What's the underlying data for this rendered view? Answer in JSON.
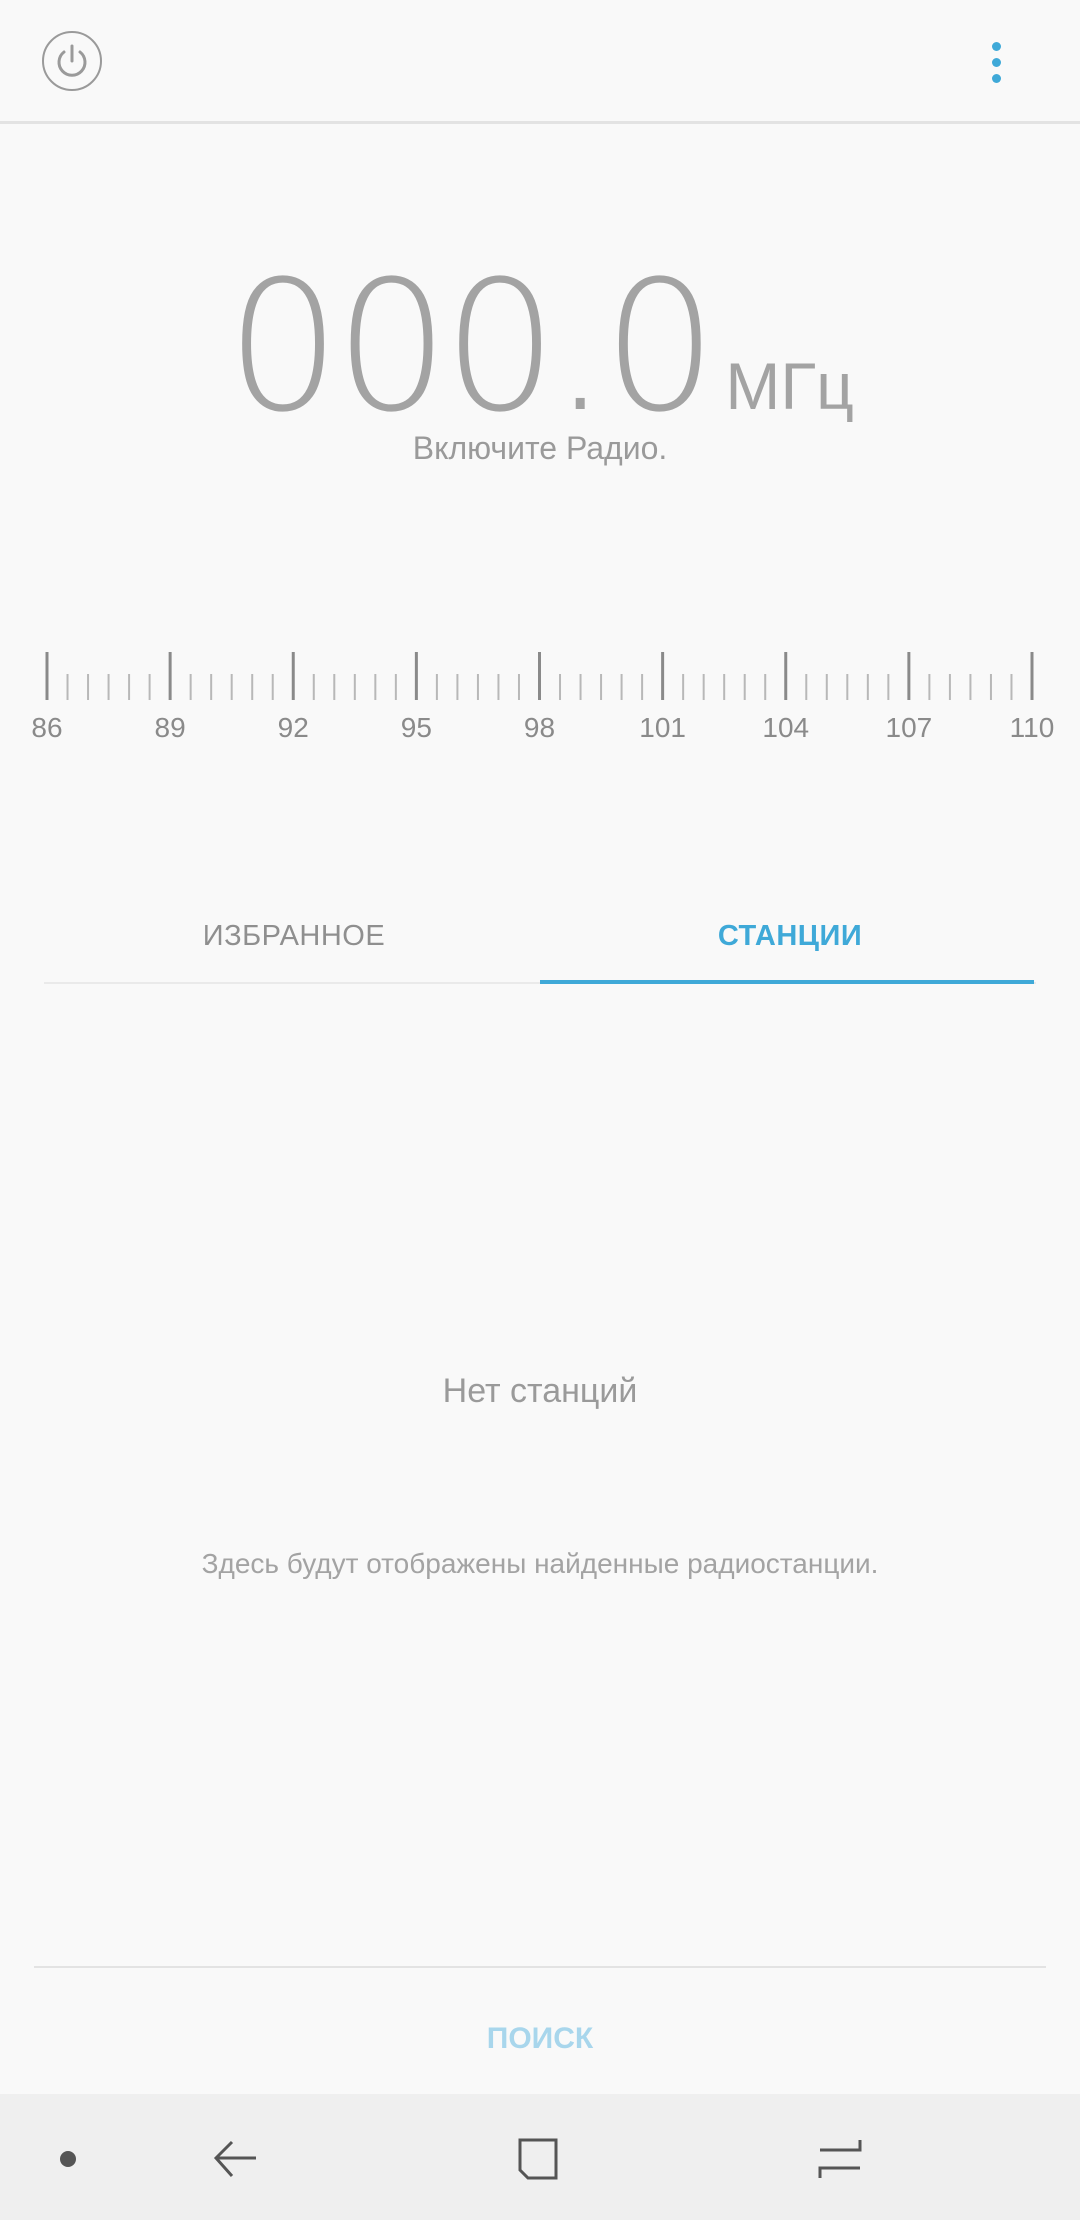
{
  "header": {
    "power_icon": "power-icon",
    "more_icon": "more-vert-icon",
    "accent_color": "#3fa9d8"
  },
  "tuner": {
    "frequency": "000.0",
    "unit": "МГц",
    "status": "Включите Радио."
  },
  "dial": {
    "min": 86,
    "max": 110,
    "labels": [
      "86",
      "89",
      "92",
      "95",
      "98",
      "101",
      "104",
      "107",
      "110"
    ]
  },
  "tabs": [
    {
      "label": "ИЗБРАННОЕ",
      "selected": false
    },
    {
      "label": "СТАНЦИИ",
      "selected": true
    }
  ],
  "empty_state": {
    "title": "Нет станций",
    "subtitle": "Здесь будут отображены найденные радиостанции."
  },
  "actions": {
    "search_label": "ПОИСК"
  },
  "navbar": {
    "items": [
      "dot-icon",
      "back-icon",
      "home-icon",
      "recents-icon"
    ]
  }
}
